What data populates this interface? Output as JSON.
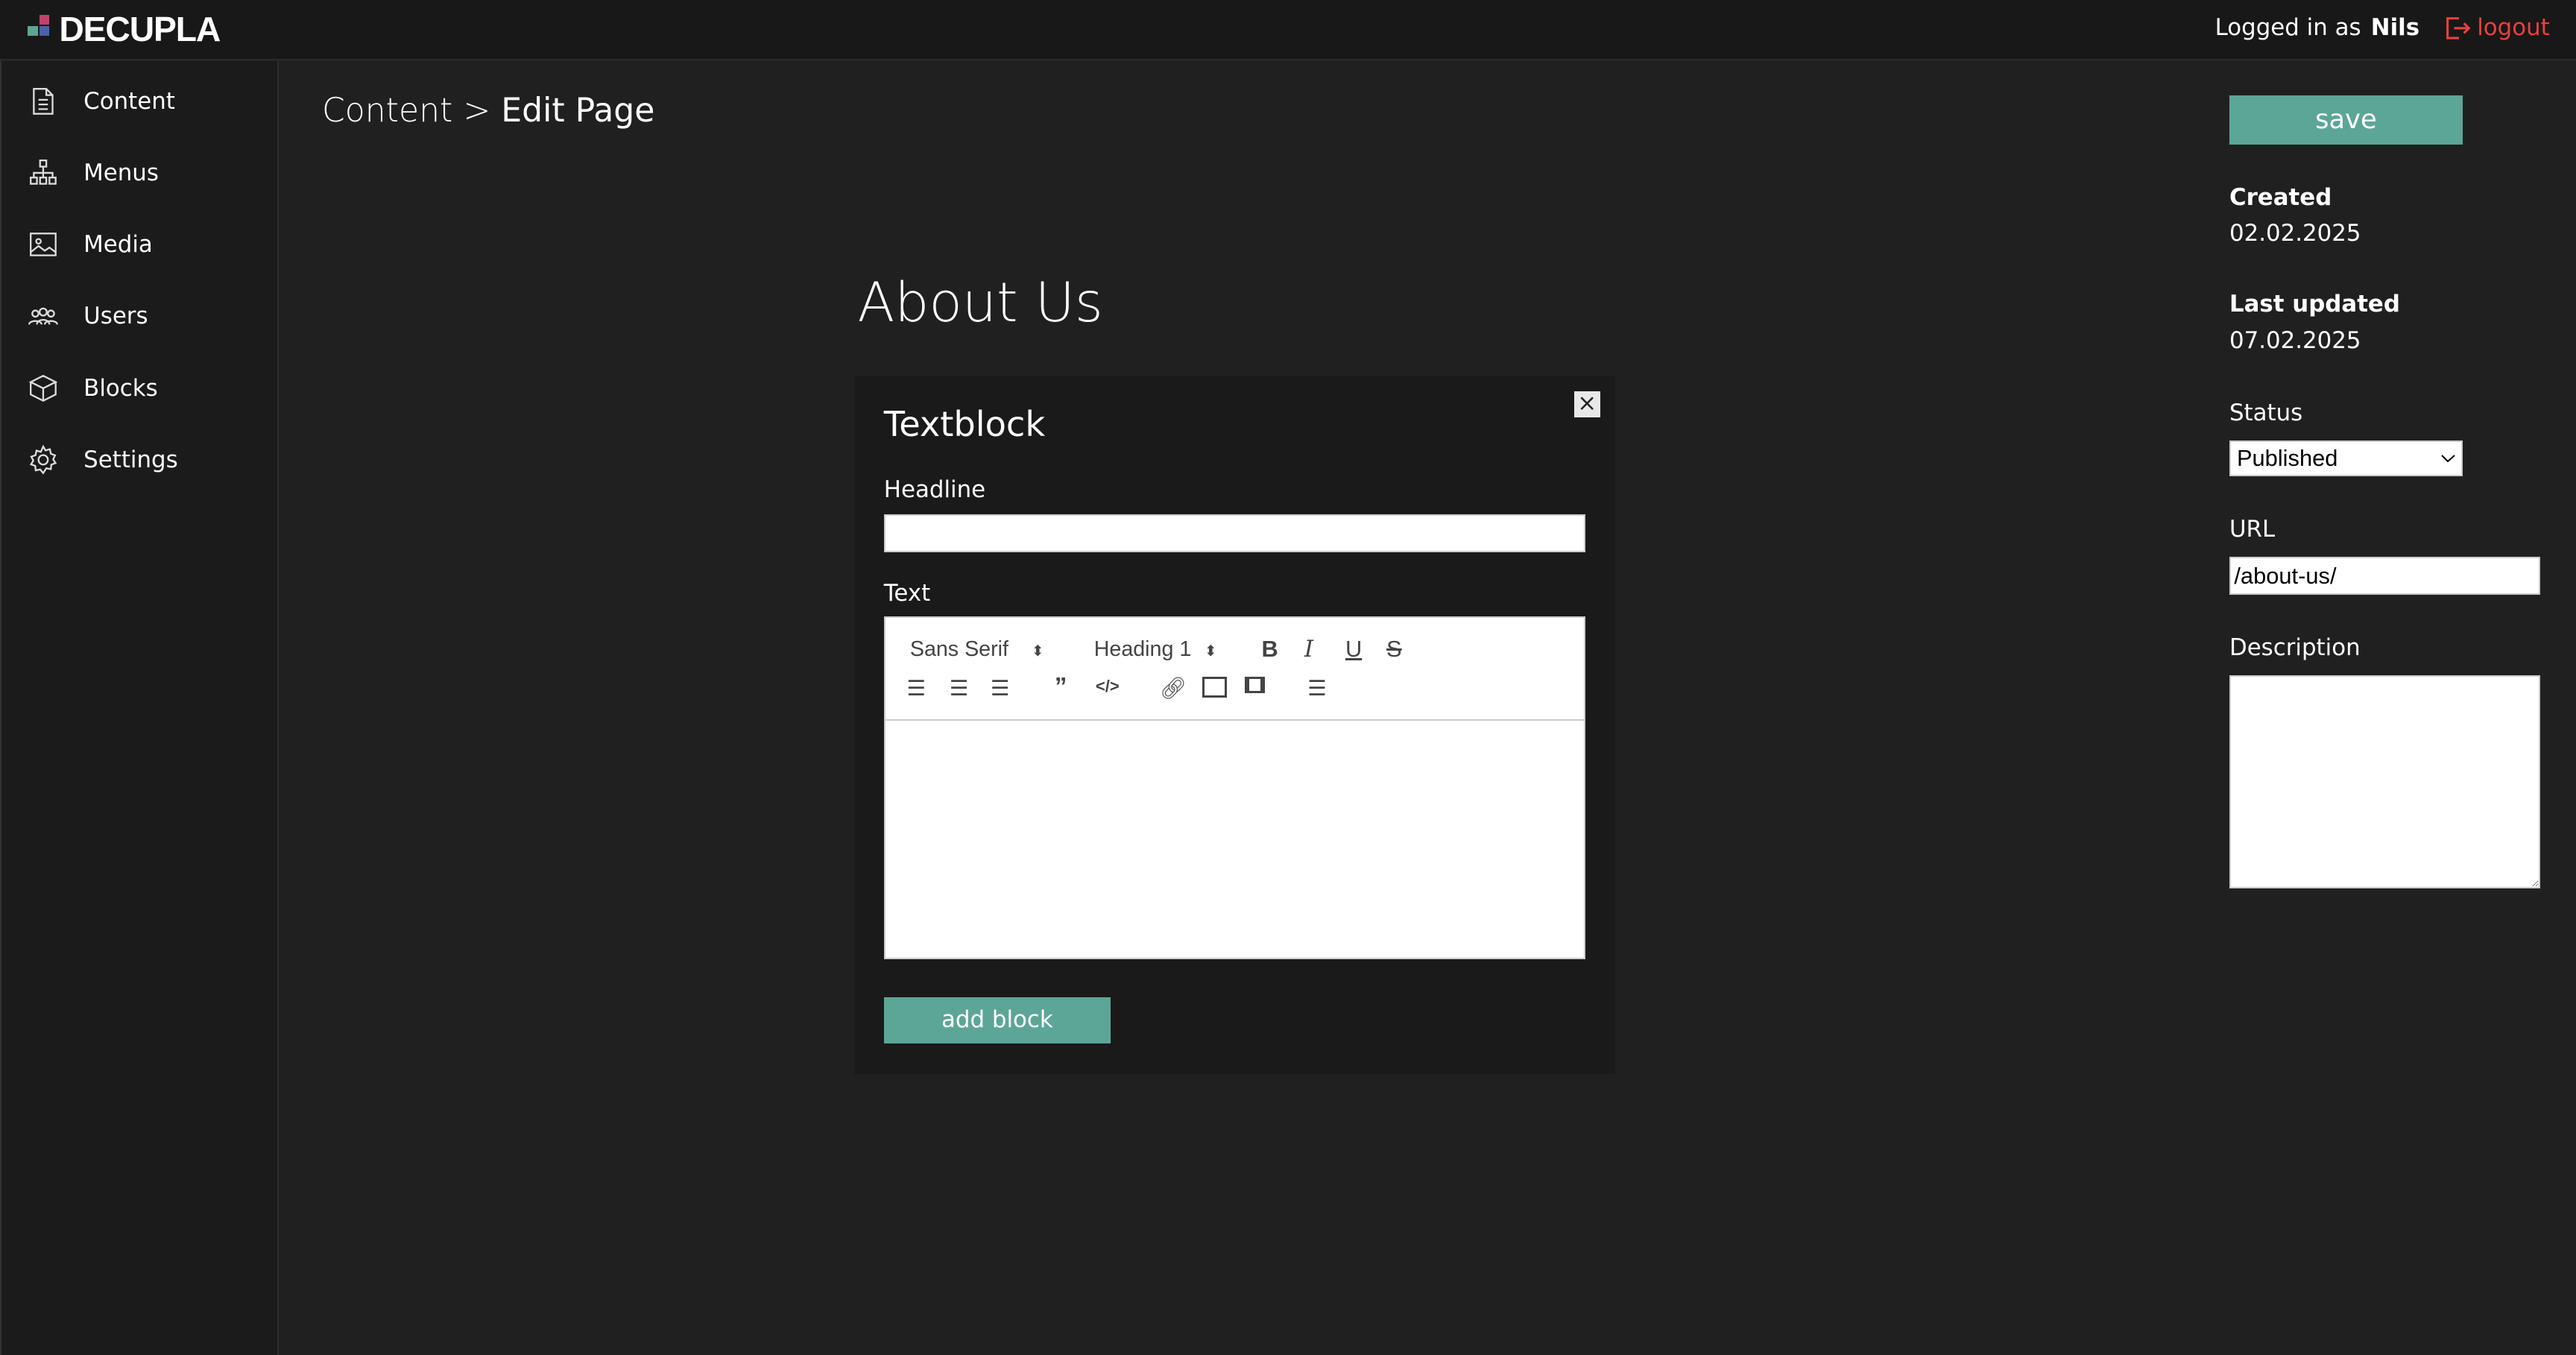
{
  "app": {
    "name": "DECUPLA",
    "logged_in_prefix": "Logged in as",
    "user": "Nils",
    "logout": "logout",
    "brand_colors": [
      "#c2426c",
      "#5ca697",
      "#4a63a8"
    ]
  },
  "sidebar": {
    "items": [
      {
        "label": "Content",
        "icon": "document-icon"
      },
      {
        "label": "Menus",
        "icon": "sitemap-icon"
      },
      {
        "label": "Media",
        "icon": "image-icon"
      },
      {
        "label": "Users",
        "icon": "users-icon"
      },
      {
        "label": "Blocks",
        "icon": "box-icon"
      },
      {
        "label": "Settings",
        "icon": "gear-icon"
      }
    ]
  },
  "breadcrumb": {
    "parent": "Content",
    "sep": ">",
    "current": "Edit Page"
  },
  "page": {
    "title": "About Us"
  },
  "block": {
    "title": "Textblock",
    "headline_label": "Headline",
    "headline_value": "",
    "text_label": "Text",
    "font": "Sans Serif",
    "heading": "Heading 1",
    "add_block": "add block"
  },
  "meta": {
    "save": "save",
    "created_label": "Created",
    "created": "02.02.2025",
    "updated_label": "Last updated",
    "updated": "07.02.2025",
    "status_label": "Status",
    "status": "Published",
    "url_label": "URL",
    "url": "/about-us/",
    "description_label": "Description",
    "description": ""
  },
  "colors": {
    "accent": "#5ca697",
    "logout": "#e8413d"
  }
}
